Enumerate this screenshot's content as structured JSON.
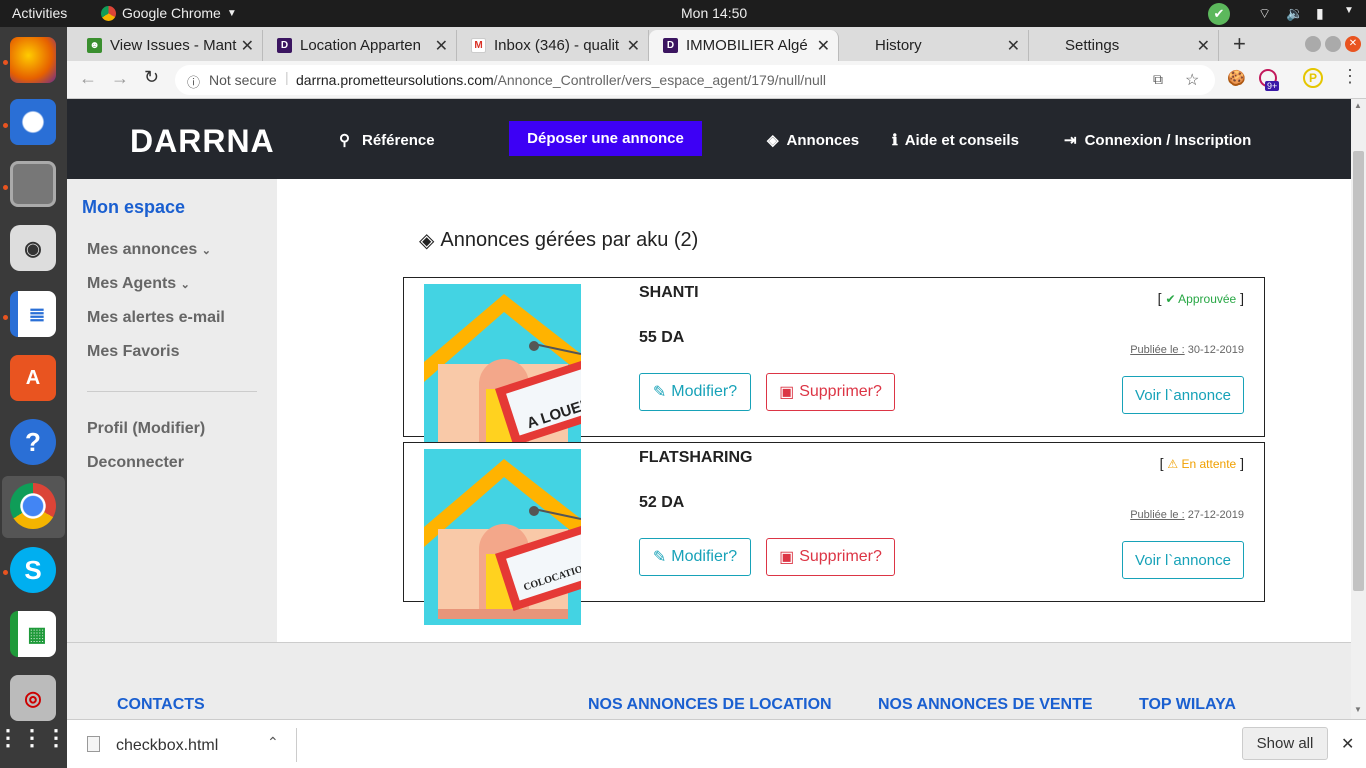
{
  "system": {
    "activities": "Activities",
    "app": "Google Chrome",
    "clock": "Mon 14:50"
  },
  "tabs": [
    {
      "title": "View Issues - Mant",
      "fav_color": "#3a8f2f",
      "fav_text": "☻"
    },
    {
      "title": "Location Apparten",
      "fav_color": "#3b1560",
      "fav_text": "D"
    },
    {
      "title": "Inbox (346) - qualit",
      "fav_color": "#ffffff",
      "fav_text": "M"
    },
    {
      "title": "IMMOBILIER Algé",
      "fav_color": "#3b1560",
      "fav_text": "D",
      "active": true
    },
    {
      "title": "History",
      "fav_color": "#dcdcdc",
      "fav_text": ""
    },
    {
      "title": "Settings",
      "fav_color": "#dcdcdc",
      "fav_text": ""
    }
  ],
  "addressbar": {
    "security": "Not secure",
    "host": "darrna.prometteursolutions.com",
    "path": "/Annonce_Controller/vers_espace_agent/179/null/null",
    "extension_badge": "9+"
  },
  "site": {
    "logo": "DARRNA",
    "nav": {
      "reference": "Référence",
      "deposer": "Déposer une annonce",
      "annonces": "Annonces",
      "aide": "Aide et conseils",
      "connexion": "Connexion / Inscription"
    }
  },
  "sidebar": {
    "title": "Mon espace",
    "items": [
      "Mes annonces",
      "Mes Agents",
      "Mes alertes e-mail",
      "Mes Favoris"
    ],
    "profile": "Profil (Modifier)",
    "logout": "Deconnecter"
  },
  "main": {
    "heading": "Annonces gérées par aku (2)",
    "listings": [
      {
        "title": "SHANTI",
        "price": "55 DA",
        "status": "Approuvée",
        "status_color": "#28a745",
        "published_label": "Publiée le :",
        "published_date": "30-12-2019",
        "sign_text": "A LOUER",
        "modify": "Modifier?",
        "delete": "Supprimer?",
        "view": "Voir l`annonce"
      },
      {
        "title": "FLATSHARING",
        "price": "52 DA",
        "status": "En attente",
        "status_color": "#f0a000",
        "published_label": "Publiée le :",
        "published_date": "27-12-2019",
        "sign_text": "COLOCATION",
        "modify": "Modifier?",
        "delete": "Supprimer?",
        "view": "Voir l`annonce"
      }
    ]
  },
  "footer": {
    "contacts": "CONTACTS",
    "location": "NOS ANNONCES DE LOCATION",
    "vente": "NOS ANNONCES DE VENTE",
    "wilaya": "TOP WILAYA"
  },
  "download": {
    "file": "checkbox.html",
    "show_all": "Show all"
  },
  "colors": {
    "brand_blue": "#3d00f5",
    "header_dark": "#24272d",
    "link_blue": "#1a5fd0"
  }
}
